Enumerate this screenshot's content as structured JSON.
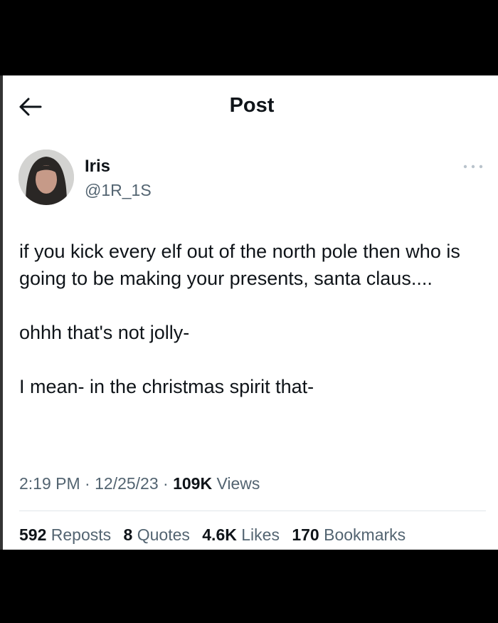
{
  "header": {
    "title": "Post",
    "back_icon": "arrow-left-icon"
  },
  "author": {
    "name": "Iris",
    "handle": "@1R_1S",
    "more_icon": "more-horizontal-icon"
  },
  "post": {
    "paragraphs": [
      "if you kick every elf out of the north pole then who is going to be making your presents, santa claus....",
      "ohhh that's not jolly-",
      "I mean- in the christmas spirit that-"
    ],
    "time": "2:19 PM",
    "date": "12/25/23",
    "views_count": "109K",
    "views_label": "Views",
    "separator": "·"
  },
  "stats": [
    {
      "count": "592",
      "label": "Reposts"
    },
    {
      "count": "8",
      "label": "Quotes"
    },
    {
      "count": "4.6K",
      "label": "Likes"
    },
    {
      "count": "170",
      "label": "Bookmarks"
    }
  ],
  "colors": {
    "text_primary": "#0f1419",
    "text_secondary": "#536471",
    "background": "#ffffff",
    "letterbox": "#000000"
  }
}
